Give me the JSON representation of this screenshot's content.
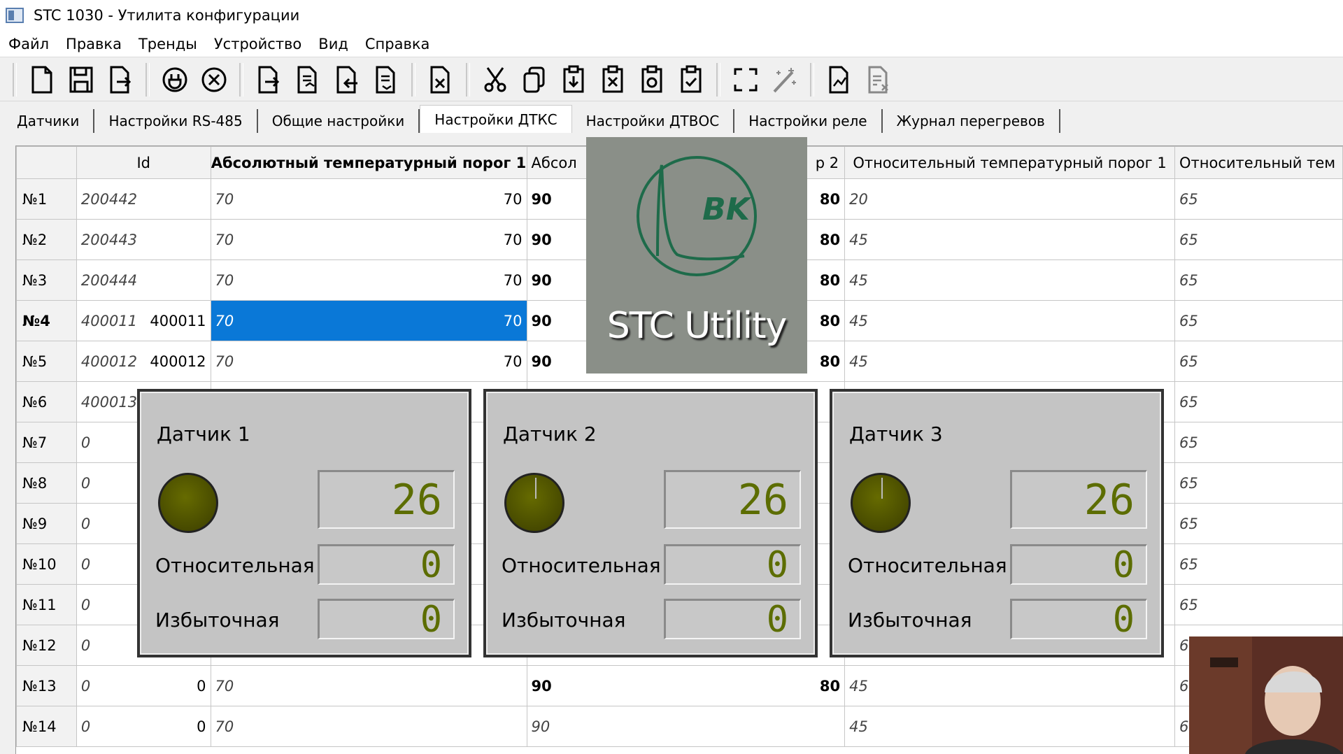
{
  "window": {
    "title": "STC 1030 - Утилита конфигурации"
  },
  "menu": [
    "Файл",
    "Правка",
    "Тренды",
    "Устройство",
    "Вид",
    "Справка"
  ],
  "toolbar": {
    "buttons": [
      "new-file-icon",
      "save-icon",
      "export-icon",
      "connect-icon",
      "disconnect-icon",
      "read-icon",
      "read-all-icon",
      "write-icon",
      "write-all-icon",
      "delete-icon",
      "cut-icon",
      "copy-icon",
      "paste-icon",
      "clear-icon",
      "reset-icon",
      "apply-icon",
      "fullscreen-icon",
      "magic-icon",
      "report-icon",
      "report-clear-icon"
    ]
  },
  "tabs": [
    "Датчики",
    "Настройки RS-485",
    "Общие настройки",
    "Настройки ДТКС",
    "Настройки ДТВОС",
    "Настройки реле",
    "Журнал перегревов"
  ],
  "active_tab": "Настройки ДТКС",
  "grid": {
    "columns": [
      "Id",
      "Абсолютный температурный порог 1",
      "Абсол",
      "р 2",
      "Относительный температурный порог 1",
      "Относительный тем"
    ],
    "rows": [
      {
        "h": "№1",
        "id": "200442",
        "idr": "",
        "a1": "70",
        "a1r": "70",
        "a2": "90",
        "a2r": "80",
        "r1": "20",
        "r2": "65"
      },
      {
        "h": "№2",
        "id": "200443",
        "idr": "",
        "a1": "70",
        "a1r": "70",
        "a2": "90",
        "a2r": "80",
        "r1": "45",
        "r2": "65"
      },
      {
        "h": "№3",
        "id": "200444",
        "idr": "",
        "a1": "70",
        "a1r": "70",
        "a2": "90",
        "a2r": "80",
        "r1": "45",
        "r2": "65"
      },
      {
        "h": "№4",
        "id": "400011",
        "idr": "400011",
        "a1": "70",
        "a1r": "70",
        "a2": "90",
        "a2r": "80",
        "r1": "45",
        "r2": "65"
      },
      {
        "h": "№5",
        "id": "400012",
        "idr": "400012",
        "a1": "70",
        "a1r": "70",
        "a2": "90",
        "a2r": "80",
        "r1": "45",
        "r2": "65"
      },
      {
        "h": "№6",
        "id": "400013",
        "idr": "",
        "a1": "",
        "a1r": "",
        "a2": "",
        "a2r": "",
        "r1": "",
        "r2": "65"
      },
      {
        "h": "№7",
        "id": "0",
        "idr": "",
        "a1": "",
        "a1r": "",
        "a2": "",
        "a2r": "",
        "r1": "",
        "r2": "65"
      },
      {
        "h": "№8",
        "id": "0",
        "idr": "",
        "a1": "",
        "a1r": "",
        "a2": "",
        "a2r": "",
        "r1": "",
        "r2": "65"
      },
      {
        "h": "№9",
        "id": "0",
        "idr": "",
        "a1": "",
        "a1r": "",
        "a2": "",
        "a2r": "",
        "r1": "",
        "r2": "65"
      },
      {
        "h": "№10",
        "id": "0",
        "idr": "",
        "a1": "",
        "a1r": "",
        "a2": "",
        "a2r": "",
        "r1": "",
        "r2": "65"
      },
      {
        "h": "№11",
        "id": "0",
        "idr": "",
        "a1": "",
        "a1r": "",
        "a2": "",
        "a2r": "",
        "r1": "",
        "r2": "65"
      },
      {
        "h": "№12",
        "id": "0",
        "idr": "",
        "a1": "",
        "a1r": "",
        "a2": "",
        "a2r": "",
        "r1": "",
        "r2": "6"
      },
      {
        "h": "№13",
        "id": "0",
        "idr": "0",
        "a1": "70",
        "a1r": "",
        "a2": "90",
        "a2r": "80",
        "r1": "45",
        "r2": "6"
      },
      {
        "h": "№14",
        "id": "0",
        "idr": "0",
        "a1": "70",
        "a1r": "",
        "a2": "90",
        "a2r": "",
        "r1": "45",
        "r2": "6"
      }
    ]
  },
  "splash": {
    "text": "STC Utility",
    "logo": "BK"
  },
  "sensors": [
    {
      "title": "Датчик 1",
      "value": "26",
      "relative_label": "Относительная",
      "relative": "0",
      "excess_label": "Избыточная",
      "excess": "0"
    },
    {
      "title": "Датчик 2",
      "value": "26",
      "relative_label": "Относительная",
      "relative": "0",
      "excess_label": "Избыточная",
      "excess": "0"
    },
    {
      "title": "Датчик 3",
      "value": "26",
      "relative_label": "Относительная",
      "relative": "0",
      "excess_label": "Избыточная",
      "excess": "0"
    }
  ],
  "colors": {
    "selection": "#0a78d7",
    "lcd": "#5c6d00",
    "logo_green": "#1e6b4a"
  }
}
